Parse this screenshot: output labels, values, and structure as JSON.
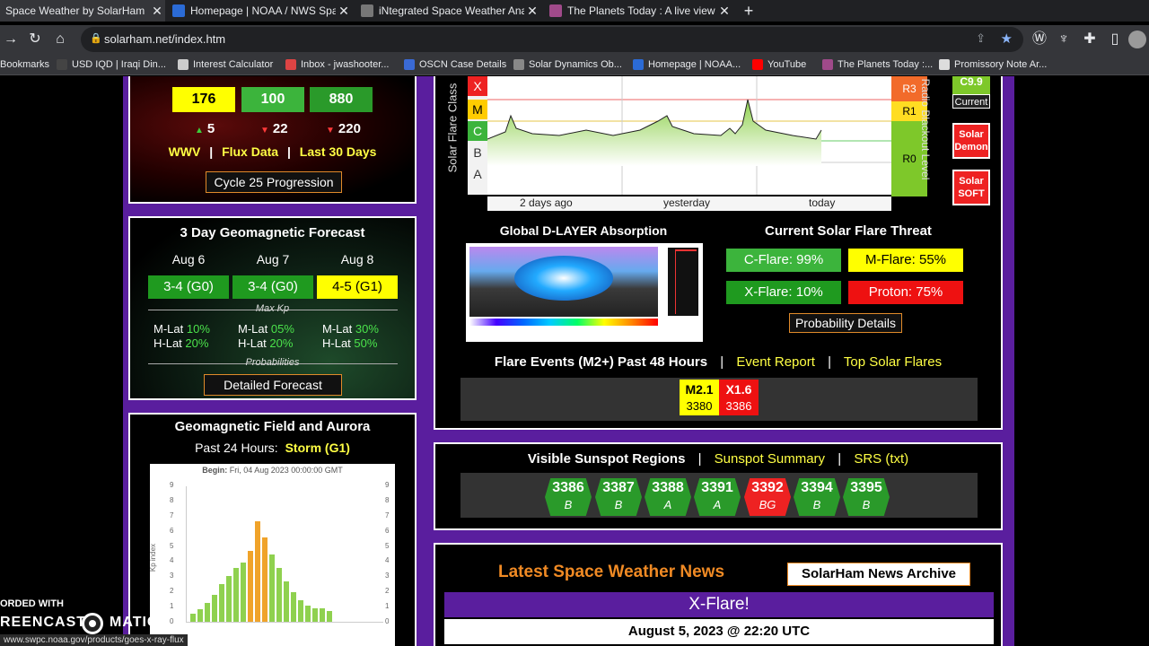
{
  "browser": {
    "tabs": [
      {
        "title": "Space Weather by SolarHam",
        "active": true
      },
      {
        "title": "Homepage | NOAA / NWS Space",
        "active": false
      },
      {
        "title": "iNtegrated Space Weather Analy",
        "active": false
      },
      {
        "title": "The Planets Today : A live view of",
        "active": false
      }
    ],
    "url": "solarham.net/index.htm",
    "bookmarks": [
      "Bookmarks",
      "USD IQD | Iraqi Din...",
      "Interest Calculator",
      "Inbox - jwashooter...",
      "OSCN Case Details",
      "Solar Dynamics Ob...",
      "Homepage | NOAA...",
      "YouTube",
      "The Planets Today :...",
      "Promissory Note Ar..."
    ]
  },
  "flux": {
    "values": [
      "176",
      "100",
      "880"
    ],
    "changes": [
      "5",
      "22",
      "220"
    ],
    "links": [
      "WWV",
      "Flux Data",
      "Last 30 Days"
    ],
    "separator": "|",
    "progression_label": "Cycle 25 Progression"
  },
  "geo_forecast": {
    "title": "3 Day Geomagnetic Forecast",
    "days": [
      {
        "date": "Aug 6",
        "kp": "3-4 (G0)",
        "mlat": "10%",
        "hlat": "20%"
      },
      {
        "date": "Aug 7",
        "kp": "3-4 (G0)",
        "mlat": "05%",
        "hlat": "20%"
      },
      {
        "date": "Aug 8",
        "kp": "4-5 (G1)",
        "mlat": "30%",
        "hlat": "50%"
      }
    ],
    "mlat_label": "M-Lat",
    "hlat_label": "H-Lat",
    "max_kp_label": "Max Kp",
    "probabilities_label": "Probabilities",
    "detailed_label": "Detailed Forecast"
  },
  "geo_field": {
    "title": "Geomagnetic Field and Aurora",
    "past_label": "Past 24 Hours:",
    "status": "Storm (G1)",
    "chart_begin": "Begin:",
    "chart_begin_value": "Fri, 04 Aug 2023 00:00:00 GMT",
    "ylabel": "Kp index",
    "yticks": [
      "9",
      "8",
      "7",
      "6",
      "5",
      "4",
      "3",
      "2",
      "1",
      "0"
    ]
  },
  "xray_chart": {
    "ylabel": "Solar Flare Class",
    "classes": [
      "X",
      "M",
      "C",
      "B",
      "A"
    ],
    "xlabels": [
      "2 days ago",
      "yesterday",
      "today"
    ],
    "blackout_label": "Radio Blackout Level",
    "levels": [
      "R3",
      "R1",
      "R0"
    ],
    "current_value": "C9.9",
    "current_label": "Current",
    "demon_label": "Solar Demon",
    "soft_label": "Solar SOFT"
  },
  "dlayer": {
    "title": "Global D-LAYER Absorption"
  },
  "flare_threat": {
    "title": "Current Solar Flare Threat",
    "items": [
      {
        "label": "C-Flare: 99%"
      },
      {
        "label": "M-Flare: 55%"
      },
      {
        "label": "X-Flare: 10%"
      },
      {
        "label": "Proton: 75%"
      }
    ],
    "details_label": "Probability Details"
  },
  "flare_events": {
    "title": "Flare Events (M2+) Past 48 Hours",
    "link1": "Event Report",
    "link2": "Top Solar Flares",
    "events": [
      {
        "cls": "M2.1",
        "region": "3380"
      },
      {
        "cls": "X1.6",
        "region": "3386"
      }
    ]
  },
  "sunspots": {
    "title": "Visible Sunspot Regions",
    "link1": "Sunspot Summary",
    "link2": "SRS (txt)",
    "regions": [
      {
        "num": "3386",
        "cls": "B"
      },
      {
        "num": "3387",
        "cls": "B"
      },
      {
        "num": "3388",
        "cls": "A"
      },
      {
        "num": "3391",
        "cls": "A"
      },
      {
        "num": "3392",
        "cls": "BG"
      },
      {
        "num": "3394",
        "cls": "B"
      },
      {
        "num": "3395",
        "cls": "B"
      }
    ]
  },
  "news": {
    "title": "Latest Space Weather News",
    "archive_label": "SolarHam News Archive",
    "headline": "X-Flare!",
    "date": "August 5, 2023 @ 22:20 UTC"
  },
  "overlay": {
    "status_url": "www.swpc.noaa.gov/products/goes-x-ray-flux",
    "watermark_top": "ORDED WITH",
    "watermark_left": "REENCAST",
    "watermark_right": "MATIC"
  },
  "colors": {
    "green": "#2a9a2a",
    "yellow": "#ffff00",
    "red": "#ee1111",
    "purple": "#5a1e9e"
  }
}
